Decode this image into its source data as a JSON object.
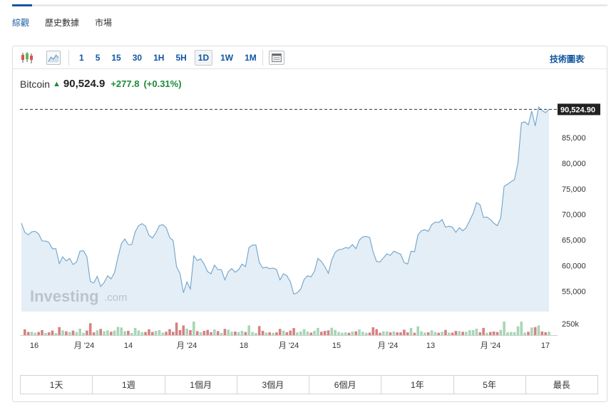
{
  "subnav": {
    "items": [
      "綜觀",
      "歷史數據",
      "市場"
    ],
    "active": 0
  },
  "toolbar": {
    "chart_icons": [
      "candlestick-icon",
      "line-chart-icon"
    ],
    "intervals": [
      "1",
      "5",
      "15",
      "30",
      "1H",
      "5H",
      "1D",
      "1W",
      "1M"
    ],
    "active_interval": "1D",
    "calendar_icon": "calendar-icon",
    "tech_chart_label": "技術圖表",
    "tech_arrow": "»"
  },
  "quote": {
    "name": "Bitcoin",
    "last": "90,524.9",
    "change": "+277.8",
    "change_pct": "(+0.31%)",
    "up_color": "#1b8a3a"
  },
  "watermark": {
    "brand": "Investing",
    "suffix": ".com"
  },
  "colors": {
    "line": "#6fa3c9",
    "area": "#e4eef7",
    "vol_up": "#a8d5b5",
    "vol_down": "#d98080",
    "price_tag": "#222222"
  },
  "chart_data": {
    "type": "area",
    "price_tag": "90,524.90",
    "y_ticks": [
      85000,
      80000,
      75000,
      70000,
      65000,
      60000,
      55000
    ],
    "y_tick_labels": [
      "85,000",
      "80,000",
      "75,000",
      "70,000",
      "65,000",
      "60,000",
      "55,000"
    ],
    "ylim": [
      51000,
      91700
    ],
    "volume_label": "250k",
    "x_tick_labels": [
      "16",
      "月 '24",
      "14",
      "月 '24",
      "18",
      "月 '24",
      "15",
      "月 '24",
      "13",
      "月 '24",
      "17"
    ],
    "values": [
      68300,
      66500,
      66000,
      66600,
      66700,
      66200,
      64800,
      64800,
      64500,
      63300,
      63300,
      60400,
      61700,
      60900,
      61400,
      60200,
      60700,
      62800,
      62900,
      61700,
      56900,
      56600,
      57900,
      55900,
      56700,
      58000,
      57400,
      58600,
      61600,
      64300,
      65200,
      64100,
      64100,
      66600,
      67800,
      68200,
      67700,
      65900,
      65400,
      66400,
      67800,
      68000,
      67400,
      65500,
      64900,
      59800,
      58400,
      54700,
      56800,
      55400,
      61900,
      61000,
      61300,
      60300,
      58800,
      58400,
      60100,
      59200,
      59200,
      57200,
      58800,
      59400,
      58700,
      59200,
      60300,
      59800,
      63500,
      64000,
      64000,
      60600,
      59500,
      59700,
      59400,
      59500,
      59200,
      57200,
      58400,
      58000,
      56800,
      54400,
      54700,
      55400,
      57300,
      58000,
      57800,
      58900,
      61400,
      60800,
      59800,
      58500,
      61100,
      62600,
      63100,
      63200,
      63500,
      63400,
      64100,
      63300,
      65000,
      65600,
      65700,
      65500,
      62700,
      60800,
      60700,
      61500,
      62300,
      62000,
      62800,
      62500,
      62200,
      60600,
      60300,
      62800,
      62700,
      66000,
      66800,
      67000,
      66700,
      68000,
      68500,
      68400,
      69000,
      67500,
      67700,
      67500,
      66500,
      67400,
      66800,
      67400,
      68800,
      70200,
      72300,
      71900,
      69400,
      69500,
      69000,
      68300,
      67800,
      69300,
      75500,
      75900,
      76400,
      76800,
      80100,
      87900,
      88100,
      87500,
      90200,
      87300,
      91000,
      90300,
      89900,
      90524
    ]
  },
  "range_bar": [
    "1天",
    "1週",
    "1個月",
    "3個月",
    "6個月",
    "1年",
    "5年",
    "最長"
  ]
}
